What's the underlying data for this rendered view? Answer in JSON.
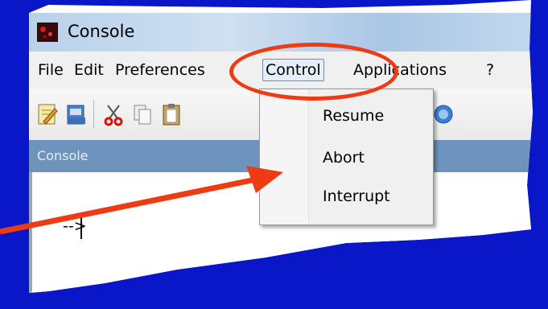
{
  "window": {
    "title": "Console",
    "icon": "app-icon"
  },
  "menubar": {
    "items": [
      "File",
      "Edit",
      "Preferences",
      "Control",
      "Applications",
      "?"
    ],
    "active": "Control"
  },
  "toolbar": {
    "icons": [
      "new-file-icon",
      "open-file-icon",
      "cut-icon",
      "copy-icon",
      "paste-icon",
      "help-icon"
    ]
  },
  "panel": {
    "title": "Console"
  },
  "console": {
    "prompt": "-->"
  },
  "control_menu": {
    "items": [
      "Resume",
      "Abort",
      "Interrupt"
    ]
  },
  "annotation": {
    "color": "#ee3b14",
    "background": "#0a17c8"
  }
}
